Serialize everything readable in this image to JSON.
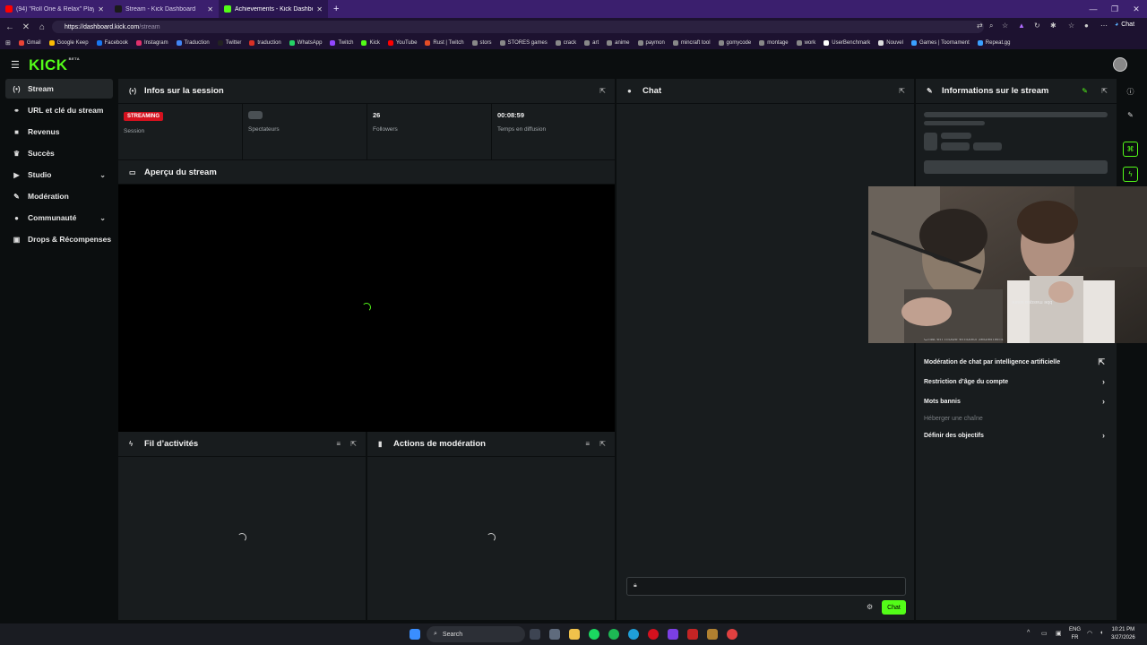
{
  "browser": {
    "tabs": [
      {
        "title": "(94) \"Roll One & Relax\" Playli",
        "active": false,
        "favicon_color": "#ff0000"
      },
      {
        "title": "Stream - Kick Dashboard",
        "active": false,
        "favicon_color": "#1a1a1a"
      },
      {
        "title": "Achievements - Kick Dashboard",
        "active": true,
        "favicon_color": "#53fc18"
      }
    ],
    "new_tab": "+",
    "url_host": "https://dashboard.kick.com",
    "url_path": "/stream",
    "chat_label": "Chat",
    "bookmarks": [
      {
        "label": "Gmail",
        "color": "#ea4335"
      },
      {
        "label": "Google Keep",
        "color": "#fbbc04"
      },
      {
        "label": "Facebook",
        "color": "#1877f2"
      },
      {
        "label": "Instagram",
        "color": "#e1306c"
      },
      {
        "label": "Traduction",
        "color": "#4285f4"
      },
      {
        "label": "Twitter",
        "color": "#222222"
      },
      {
        "label": "traduction",
        "color": "#d93025"
      },
      {
        "label": "WhatsApp",
        "color": "#25d366"
      },
      {
        "label": "Twitch",
        "color": "#9146ff"
      },
      {
        "label": "Kick",
        "color": "#53fc18"
      },
      {
        "label": "YouTube",
        "color": "#ff0000"
      },
      {
        "label": "Rust | Twitch",
        "color": "#e44d26"
      },
      {
        "label": "stors",
        "color": "#888888"
      },
      {
        "label": "STORES games",
        "color": "#888888"
      },
      {
        "label": "crack",
        "color": "#888888"
      },
      {
        "label": "art",
        "color": "#888888"
      },
      {
        "label": "anime",
        "color": "#888888"
      },
      {
        "label": "paymon",
        "color": "#888888"
      },
      {
        "label": "mincraft tool",
        "color": "#888888"
      },
      {
        "label": "gomycode",
        "color": "#888888"
      },
      {
        "label": "montage",
        "color": "#888888"
      },
      {
        "label": "work",
        "color": "#888888"
      },
      {
        "label": "UserBenchmark",
        "color": "#ffffff"
      },
      {
        "label": "Nouvel",
        "color": "#dddddd"
      },
      {
        "label": "Games | Toornament",
        "color": "#3aa0ff"
      },
      {
        "label": "Repeat.gg",
        "color": "#3aa0ff"
      }
    ]
  },
  "app": {
    "logo": "KICK",
    "logo_tag": "BETA",
    "accent": "#53fc18"
  },
  "sidebar": {
    "items": [
      {
        "label": "Stream",
        "icon": "broadcast-icon",
        "glyph": "(•)",
        "active": true
      },
      {
        "label": "URL et clé du stream",
        "icon": "link-icon",
        "glyph": "⚭",
        "active": false
      },
      {
        "label": "Revenus",
        "icon": "money-icon",
        "glyph": "■",
        "active": false
      },
      {
        "label": "Succès",
        "icon": "trophy-icon",
        "glyph": "♛",
        "active": false
      },
      {
        "label": "Studio",
        "icon": "video-icon",
        "glyph": "▶",
        "active": false,
        "expandable": true
      },
      {
        "label": "Modération",
        "icon": "wrench-icon",
        "glyph": "✎",
        "active": false
      },
      {
        "label": "Communauté",
        "icon": "people-icon",
        "glyph": "●",
        "active": false,
        "expandable": true
      },
      {
        "label": "Drops & Récompenses",
        "icon": "gift-icon",
        "glyph": "▣",
        "active": false
      }
    ]
  },
  "session": {
    "title": "Infos sur la session",
    "status_badge": "STREAMING",
    "status_label": "Session",
    "viewers_label": "Spectateurs",
    "followers_value": "26",
    "followers_label": "Followers",
    "uptime_value": "00:08:59",
    "uptime_label": "Temps en diffusion"
  },
  "preview": {
    "title": "Aperçu du stream"
  },
  "activity": {
    "title": "Fil d’activités"
  },
  "moderation": {
    "title": "Actions de modération"
  },
  "chat": {
    "title": "Chat",
    "send_label": "Chat"
  },
  "stream_info": {
    "title": "Informations sur le stream",
    "partial_text": "Chat en mode émotes seulement",
    "settings": [
      {
        "label": "Modération de chat par intelligence artificielle",
        "icon": "external-link-icon",
        "glyph": "⇱",
        "dim": false
      },
      {
        "label": "Restriction d’âge du compte",
        "icon": "chevron-right-icon",
        "glyph": "›",
        "dim": false
      },
      {
        "label": "Mots bannis",
        "icon": "chevron-right-icon",
        "glyph": "›",
        "dim": false
      },
      {
        "label": "Héberger une chaîne",
        "icon": "",
        "glyph": "",
        "dim": true
      },
      {
        "label": "Définir des objectifs",
        "icon": "chevron-right-icon",
        "glyph": "›",
        "dim": false
      }
    ]
  },
  "webcam": {
    "overlay_text": "ǝɹıɐʍ ɐnbsɐɯ ǝqq"
  },
  "taskbar": {
    "search_placeholder": "Search",
    "lang_top": "ENG",
    "lang_bottom": "FR",
    "time": "10:21 PM",
    "date": "3/27/2026"
  }
}
